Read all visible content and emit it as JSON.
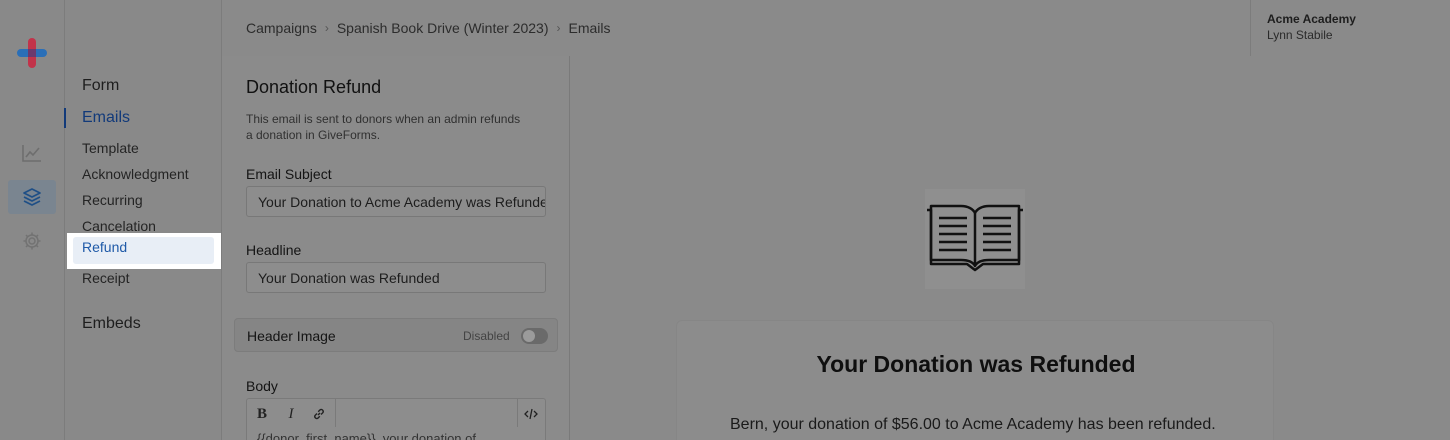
{
  "rail": {
    "icons": [
      "logo-icon",
      "chart-icon",
      "layers-icon",
      "gear-icon"
    ]
  },
  "subnav": {
    "form": "Form",
    "emails": "Emails",
    "items": [
      "Template",
      "Acknowledgment",
      "Recurring",
      "Cancelation",
      "Refund",
      "Receipt"
    ],
    "embeds": "Embeds"
  },
  "breadcrumb": [
    "Campaigns",
    "Spanish Book Drive (Winter 2023)",
    "Emails"
  ],
  "org": {
    "name": "Acme Academy",
    "user": "Lynn Stabile"
  },
  "editor": {
    "title": "Donation Refund",
    "description": "This email is sent to donors when an admin refunds a donation in GiveForms.",
    "subject_label": "Email Subject",
    "subject_value": "Your Donation to Acme Academy was Refunded",
    "headline_label": "Headline",
    "headline_value": "Your Donation was Refunded",
    "header_image_label": "Header Image",
    "header_image_state": "Disabled",
    "body_label": "Body",
    "toolbar": {
      "bold": "B",
      "italic": "I",
      "link": "link-icon",
      "code": "code-icon"
    },
    "body_text": "{{donor_first_name}}, your donation of"
  },
  "preview": {
    "image_icon": "open-book-icon",
    "headline": "Your Donation was Refunded",
    "body": "Bern, your donation of $56.00 to Acme Academy has been refunded."
  },
  "colors": {
    "accent": "#1f5aa8",
    "logo_blue": "#2a6fb8",
    "logo_red": "#d0334a"
  }
}
